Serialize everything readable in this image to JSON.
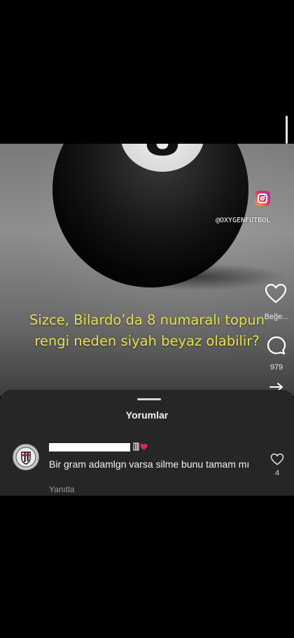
{
  "video": {
    "ball_number": "8",
    "handle": "@OXYGENFUTBOL",
    "caption_line1": "Sizce, Bilardo’da 8 numaralı topun",
    "caption_line2": "rengi neden siyah beyaz olabilir?",
    "caption_color": "#e6e14a"
  },
  "actions": {
    "like_label": "Beğe...",
    "comment_count": "979",
    "icons": [
      "heart-icon",
      "comment-icon",
      "share-icon"
    ]
  },
  "comments_sheet": {
    "title": "Yorumlar",
    "comments": [
      {
        "text": "Bir gram adamlgn varsa silme bunu tamam mı",
        "reply_label": "Yanıtla",
        "like_count": "4"
      }
    ]
  },
  "colors": {
    "background": "#000000",
    "sheet": "#262626",
    "badge_heart": "#e0245e"
  }
}
